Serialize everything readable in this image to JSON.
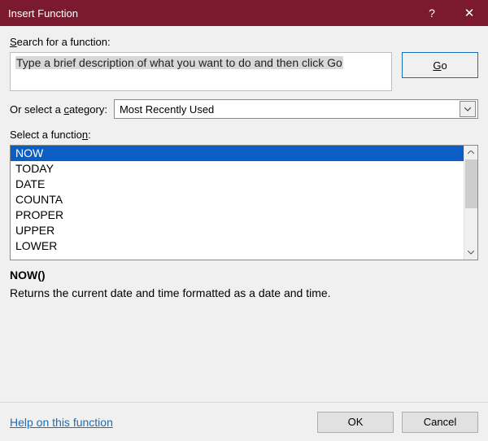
{
  "title": "Insert Function",
  "search_label_pre": "S",
  "search_label_post": "earch for a function:",
  "search_value": "Type a brief description of what you want to do and then click Go",
  "go_label_pre": "G",
  "go_label_post": "o",
  "category_label_pre": "Or select a ",
  "category_label_u": "c",
  "category_label_post": "ategory:",
  "category_value": "Most Recently Used",
  "select_label_pre": "Select a functio",
  "select_label_u": "n",
  "select_label_post": ":",
  "functions": {
    "0": "NOW",
    "1": "TODAY",
    "2": "DATE",
    "3": "COUNTA",
    "4": "PROPER",
    "5": "UPPER",
    "6": "LOWER"
  },
  "syntax": "NOW()",
  "description": "Returns the current date and time formatted as a date and time.",
  "help_link": "Help on this function",
  "ok_label": "OK",
  "cancel_label": "Cancel"
}
